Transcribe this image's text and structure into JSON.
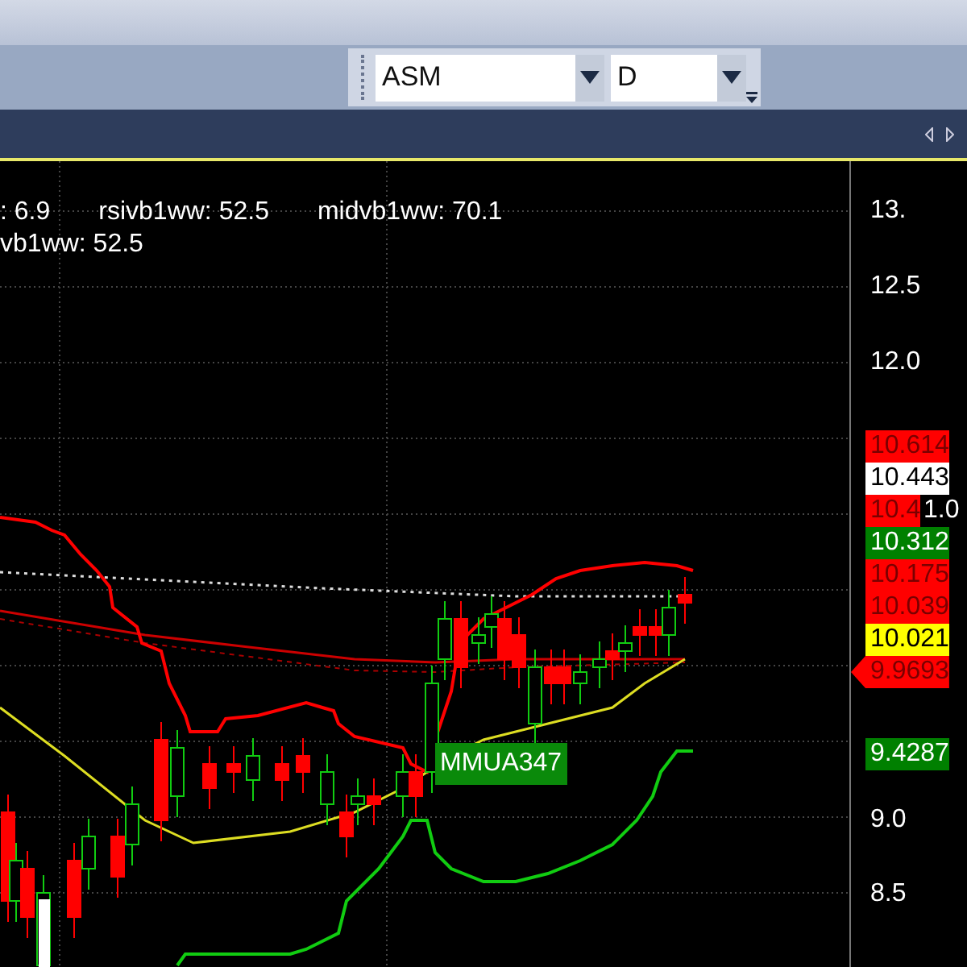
{
  "toolbar": {
    "symbol_combo": {
      "value": "ASM"
    },
    "period_combo": {
      "value": "D"
    }
  },
  "legend": [
    [
      ": 6.9",
      "rsivb1ww: 52.5",
      "midvb1ww: 70.1"
    ],
    [
      "vb1ww: 52.5"
    ]
  ],
  "chart_label": "MMUA347",
  "price_axis": {
    "upper_ticks": [
      "13.",
      "12.5",
      "12.0"
    ],
    "tag_tick": "1.0",
    "lower_ticks": [
      "9.0",
      "8.5"
    ],
    "tags": [
      {
        "text": "10.614",
        "color": "#ff0000",
        "kind": "flat"
      },
      {
        "text": "10.443",
        "color": "#ffffff",
        "kind": "flat"
      },
      {
        "text": "10.4",
        "color": "#ff0000",
        "kind": "flat"
      },
      {
        "text": "10.312",
        "color": "#008000",
        "kind": "flat"
      },
      {
        "text": "10.175",
        "color": "#ff0000",
        "kind": "flat"
      },
      {
        "text": "10.039",
        "color": "#ff0000",
        "kind": "flat"
      },
      {
        "text": "10.021",
        "color": "#ffff00",
        "kind": "flat"
      },
      {
        "text": "9.9693",
        "color": "#ff0000",
        "kind": "pointer"
      }
    ],
    "low_tag": {
      "text": "9.4287",
      "color": "#008000"
    }
  }
}
